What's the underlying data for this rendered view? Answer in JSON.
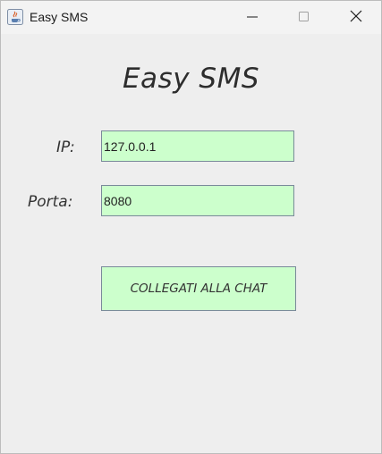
{
  "window": {
    "title": "Easy SMS",
    "icon": "java-icon",
    "controls": {
      "minimize": "minimize-icon",
      "maximize": "maximize-icon",
      "close": "close-icon"
    }
  },
  "main": {
    "heading": "Easy SMS",
    "ip_label": "IP:",
    "ip_value": "127.0.0.1",
    "port_label": "Porta:",
    "port_value": "8080",
    "connect_label": "COLLEGATI ALLA CHAT"
  },
  "colors": {
    "field_background": "#ccffcc",
    "window_background": "#eeeeee",
    "titlebar_background": "#f3f3f3"
  }
}
